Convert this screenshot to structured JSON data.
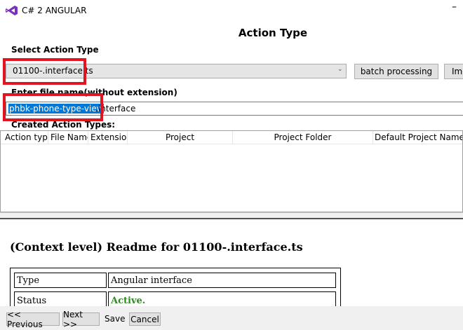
{
  "window": {
    "title": "C# 2 ANGULAR",
    "minimize_glyph": "–",
    "accent_color": "#7b2fbf"
  },
  "header": {
    "title": "Action Type"
  },
  "select_action": {
    "label": "Select Action Type",
    "selected": "01100-.interface.ts",
    "arrow": "⌄",
    "batch_label": "batch processing",
    "import_label": "Imp"
  },
  "file_name": {
    "label": "Enter file name(without extension)",
    "selected_text": "phbk-phone-type-view",
    "rest_text": ".interface"
  },
  "created": {
    "label": "Created Action Types:",
    "columns": [
      "Action type",
      "File Name",
      "Extension",
      "Project",
      "Project Folder",
      "Default Project NameSp"
    ]
  },
  "readme": {
    "title": "(Context level) Readme for 01100-.interface.ts",
    "rows": [
      {
        "key": "Type",
        "value": "Angular interface"
      },
      {
        "key": "Status",
        "value": "Active."
      }
    ],
    "status_color": "#2e8b22"
  },
  "footer": {
    "prev": "<< Previous",
    "next": "Next >>",
    "save": "Save",
    "cancel": "Cancel"
  },
  "highlight_color": "#e0151f"
}
